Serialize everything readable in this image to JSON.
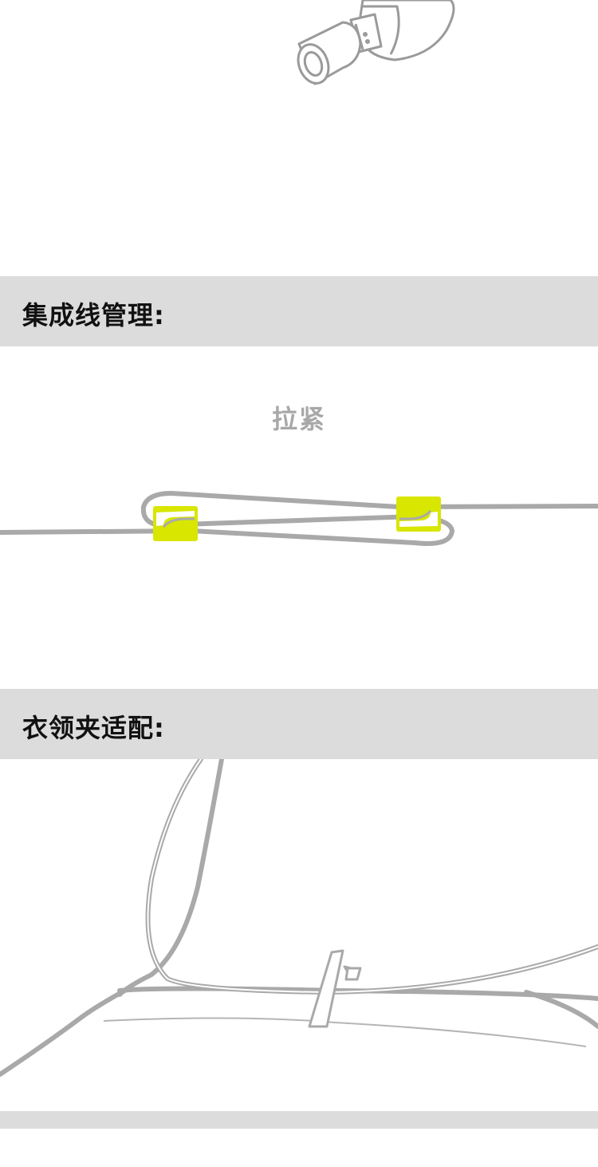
{
  "sections": [
    {
      "title": "集成线管理:"
    },
    {
      "title": "衣领夹适配:"
    }
  ],
  "cable_management": {
    "step_label": "拉紧"
  },
  "colors": {
    "band": "#dcdcdc",
    "cable": "#a9a9a9",
    "clip_accent": "#d8e600",
    "label_gray": "#a8a8a8"
  }
}
